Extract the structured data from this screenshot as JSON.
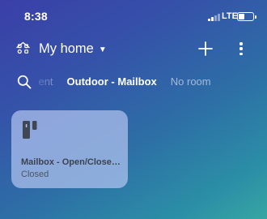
{
  "status_bar": {
    "time": "8:38",
    "network": "LTE",
    "signal_bars_active": 2,
    "signal_bars_total": 4,
    "battery_level": 0.4
  },
  "header": {
    "home_icon": "house-devices-icon",
    "title": "My home",
    "dropdown_icon": "caret-down-icon",
    "add_icon": "plus-icon",
    "more_icon": "more-vertical-icon"
  },
  "rooms": {
    "search_icon": "search-icon",
    "tabs": [
      {
        "label": "Basement",
        "active": false
      },
      {
        "label": "Outdoor - Mailbox",
        "active": true
      },
      {
        "label": "No room",
        "active": false
      }
    ]
  },
  "devices": [
    {
      "icon": "contact-sensor-icon",
      "name": "Mailbox - Open/Close Sensor",
      "state": "Closed"
    }
  ],
  "colors": {
    "gradient_start": "#3a3fa8",
    "gradient_end": "#37a6a3",
    "card_background": "#b2c4f0",
    "card_text": "#3c4350"
  }
}
